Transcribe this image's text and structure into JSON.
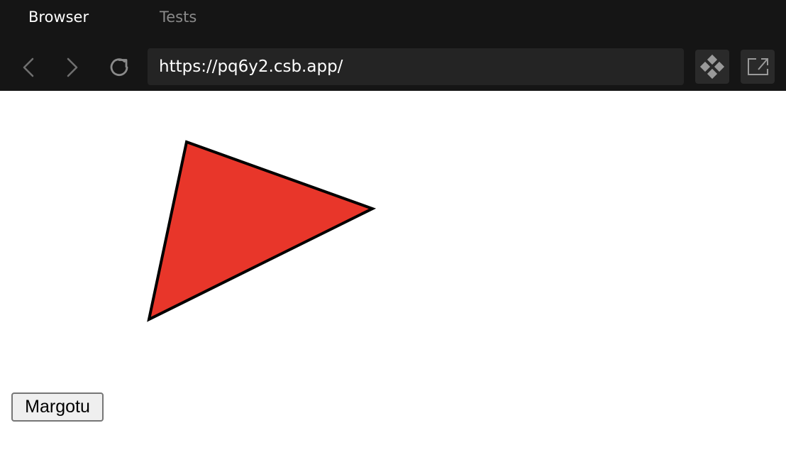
{
  "tabs": {
    "browser_label": "Browser",
    "tests_label": "Tests"
  },
  "toolbar": {
    "url": "https://pq6y2.csb.app/",
    "icons": {
      "back": "chevron-left-icon",
      "forward": "chevron-right-icon",
      "reload": "reload-icon",
      "devtools": "devtools-icon",
      "open_new": "open-in-new-window-icon"
    }
  },
  "page": {
    "shape_fill": "#e8362a",
    "shape_stroke": "#000000",
    "button_label": "Margotu"
  },
  "colors": {
    "topbar_bg": "#151515",
    "url_bg": "#242424",
    "active_tab": "#ffffff",
    "inactive_tab": "#8a8a8a"
  }
}
